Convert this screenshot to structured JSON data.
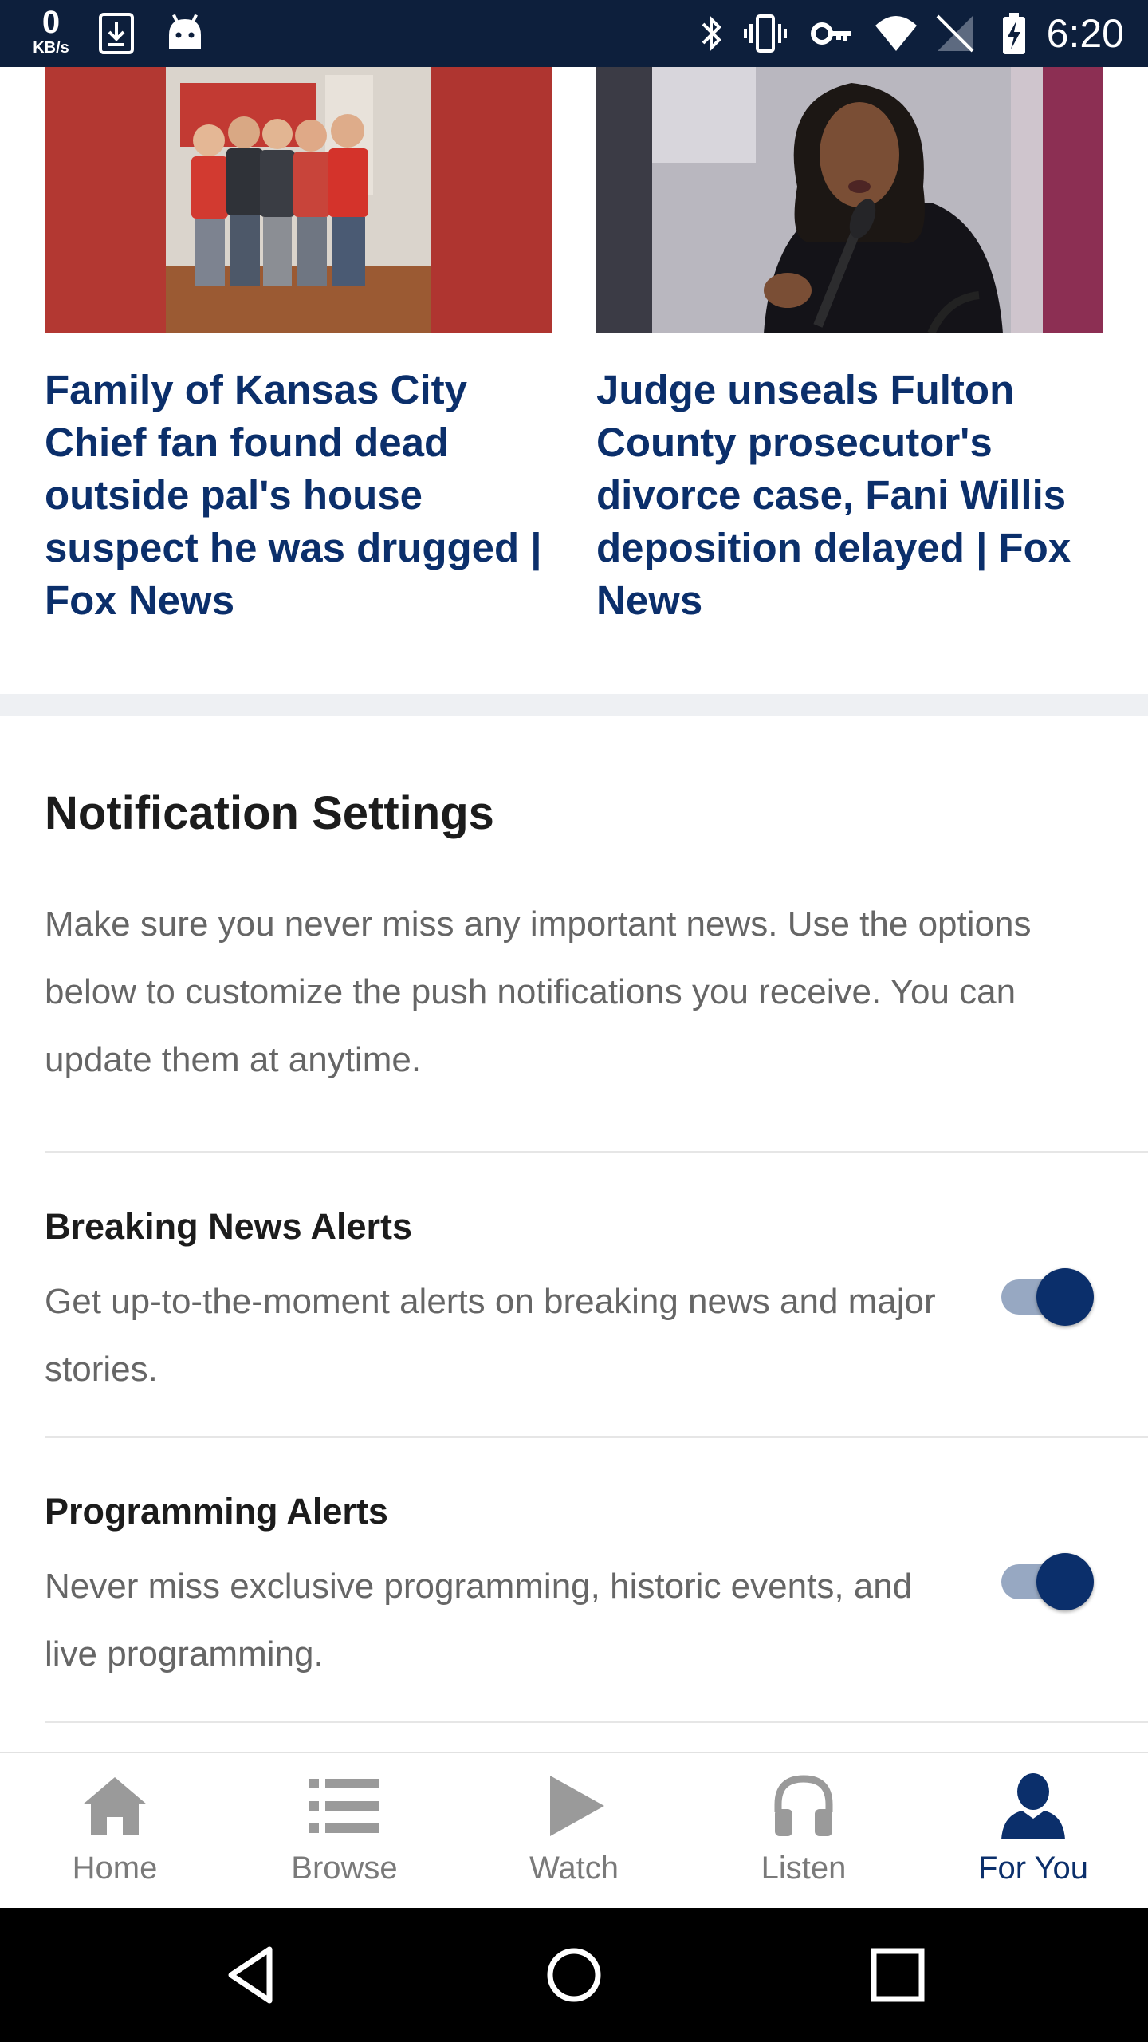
{
  "status_bar": {
    "net_speed": "0",
    "net_unit": "KB/s",
    "time": "6:20"
  },
  "articles": [
    {
      "headline": "Family of Kansas City Chief fan found dead outside pal's house suspect he was drugged | Fox News"
    },
    {
      "headline": "Judge unseals Fulton County prosecutor's divorce case, Fani Willis deposition delayed | Fox News"
    }
  ],
  "notifications": {
    "title": "Notification Settings",
    "description": "Make sure you never miss any important news. Use the options below to customize the push notifications you receive. You can update them at anytime.",
    "settings": [
      {
        "title": "Breaking News Alerts",
        "description": "Get up-to-the-moment alerts on breaking news and major stories.",
        "enabled": true
      },
      {
        "title": "Programming Alerts",
        "description": "Never miss exclusive programming, historic events, and live programming.",
        "enabled": true
      }
    ]
  },
  "bottom_nav": {
    "items": [
      {
        "label": "Home",
        "icon": "home-icon"
      },
      {
        "label": "Browse",
        "icon": "list-icon"
      },
      {
        "label": "Watch",
        "icon": "play-icon"
      },
      {
        "label": "Listen",
        "icon": "headphones-icon"
      },
      {
        "label": "For You",
        "icon": "person-icon",
        "active": true
      }
    ]
  },
  "colors": {
    "brand_navy": "#0b2f6b",
    "status_bar": "#0d1f3c",
    "toggle_track": "#97a8c2",
    "inactive_nav": "#9a9a9a"
  }
}
